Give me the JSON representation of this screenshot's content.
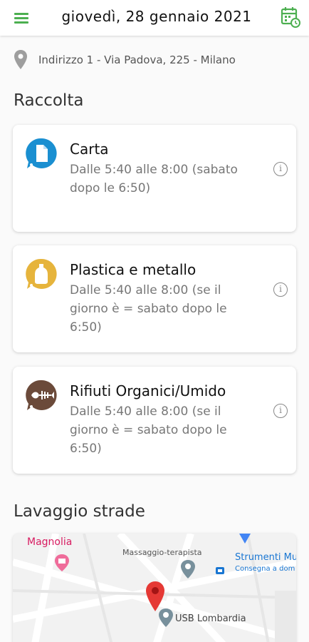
{
  "header": {
    "date": "giovedì, 28 gennaio 2021"
  },
  "address": "Indirizzo 1 - Via Padova, 225 - Milano",
  "sections": {
    "collection": "Raccolta",
    "street_cleaning": "Lavaggio strade"
  },
  "cards": [
    {
      "title": "Carta",
      "desc": "Dalle 5:40 alle 8:00 (sabato dopo le 6:50)",
      "color": "#1a8fd1",
      "icon": "paper-icon"
    },
    {
      "title": "Plastica e metallo",
      "desc": "Dalle 5:40 alle 8:00 (se il giorno è = sabato dopo le 6:50)",
      "color": "#e6b43c",
      "icon": "bottle-icon"
    },
    {
      "title": "Rifiuti Organici/Umido",
      "desc": "Dalle 5:40 alle 8:00 (se il giorno è = sabato dopo le 6:50)",
      "color": "#6b4a3a",
      "icon": "fish-bone-icon"
    }
  ],
  "map": {
    "labels": {
      "magnolia": "Magnolia",
      "massaggio": "Massaggio-terapista",
      "strumenti": "Strumenti Mu",
      "consegna": "Consegna a dom",
      "usb": "USB Lombardia"
    }
  },
  "colors": {
    "accent": "#4caf50",
    "pin_red": "#e53935"
  }
}
